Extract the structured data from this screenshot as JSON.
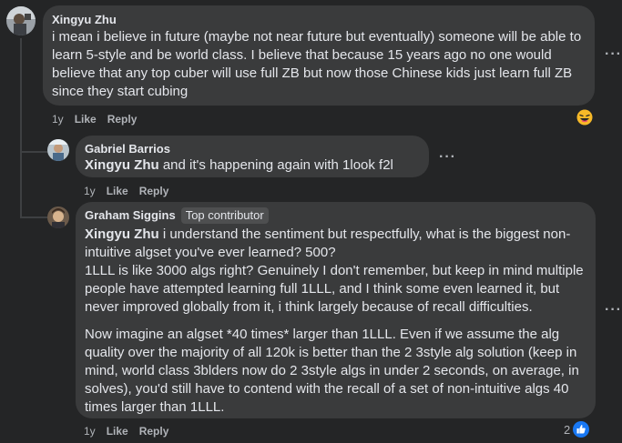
{
  "comments": [
    {
      "author": "Xingyu Zhu",
      "text": "i mean i believe in future (maybe not near future but eventually) someone will be able to learn 5-style and be world class. I believe that because 15 years ago no one would believe that any top cuber will use full ZB but now those Chinese kids just learn full ZB since they start cubing",
      "time": "1y",
      "like_label": "Like",
      "reply_label": "Reply",
      "reaction_icon": "laughing-emoji-icon"
    }
  ],
  "replies": [
    {
      "author": "Gabriel Barrios",
      "mention": "Xingyu Zhu",
      "text": "and it's happening again with 1look f2l",
      "time": "1y",
      "like_label": "Like",
      "reply_label": "Reply"
    },
    {
      "author": "Graham Siggins",
      "badge": "Top contributor",
      "mention": "Xingyu Zhu",
      "text_line1": "i understand the sentiment but respectfully, what is the biggest non-intuitive algset you've ever learned? 500?",
      "text_para1_rest": "1LLL is like 3000 algs right? Genuinely I don't remember, but keep in mind multiple people have attempted learning full 1LLL, and I think some even learned it, but never improved globally from it, i think largely because of recall difficulties.",
      "text_para2": "Now imagine an algset *40 times* larger than 1LLL. Even if we assume the alg quality over the majority of all 120k is better than the 2 3style alg solution (keep in mind, world class 3blders now do 2 3style algs in under 2 seconds, on average, in solves), you'd still have to contend with the recall of a set of non-intuitive algs 40 times larger than 1LLL.",
      "time": "1y",
      "like_label": "Like",
      "reply_label": "Reply",
      "reaction_count": "2",
      "reaction_icon": "thumbs-up-icon"
    }
  ],
  "more_label": "···",
  "colors": {
    "background": "#242526",
    "bubble": "#3a3b3c",
    "secondary_text": "#b0b3b8",
    "like_blue": "#1877f2",
    "emoji_yellow": "#f7b928"
  }
}
